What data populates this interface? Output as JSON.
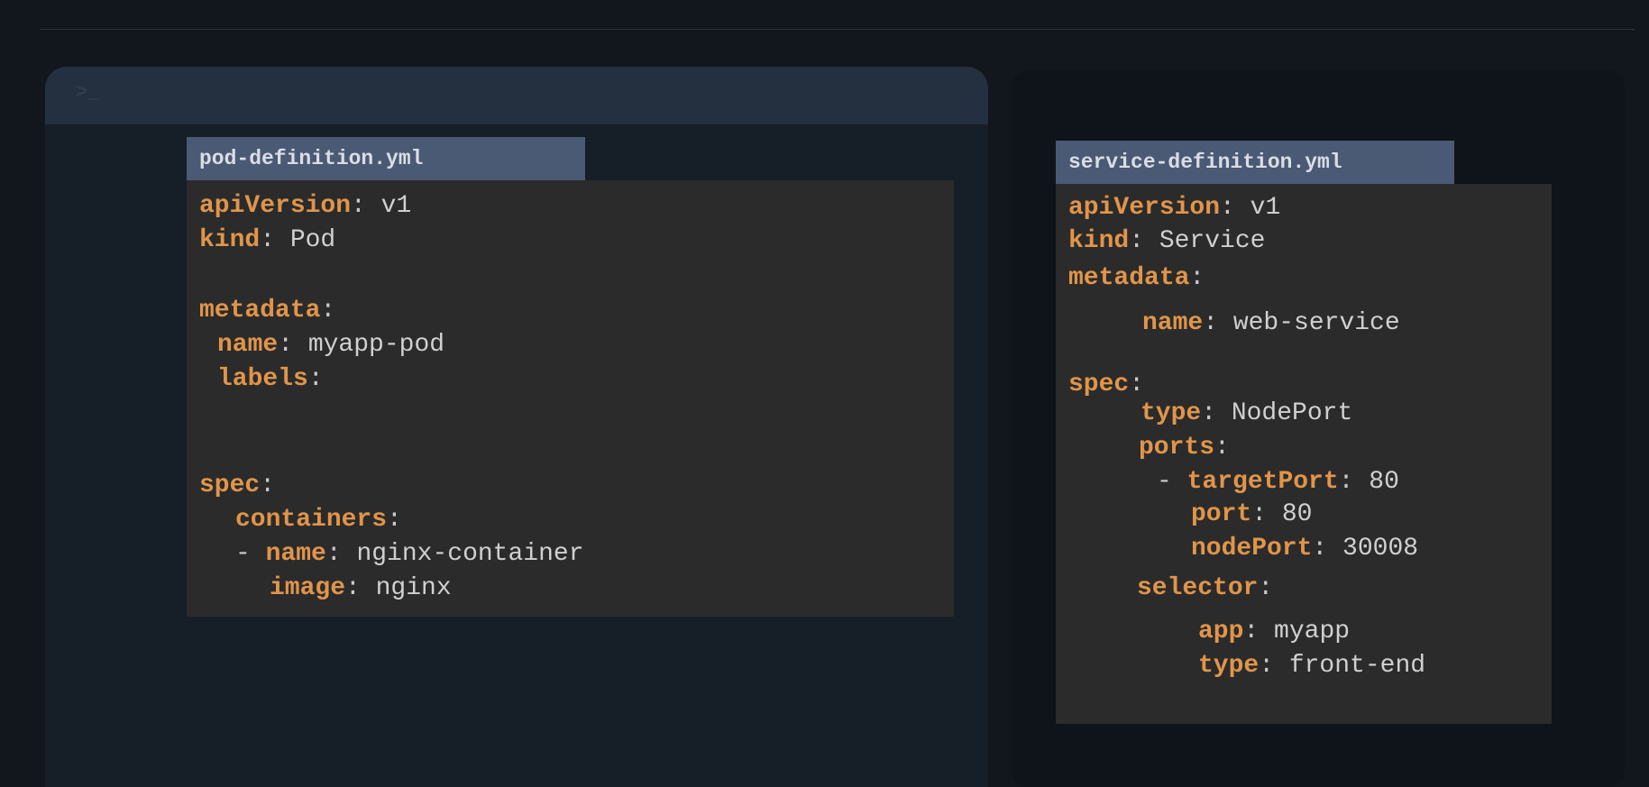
{
  "terminal": {
    "prompt": ">_"
  },
  "pod_file": {
    "filename": "pod-definition.yml",
    "lines": {
      "apiVersion": {
        "key": "apiVersion",
        "value": "v1"
      },
      "kind": {
        "key": "kind",
        "value": "Pod"
      },
      "metadata": {
        "key": "metadata"
      },
      "name": {
        "key": "name",
        "value": "myapp-pod"
      },
      "labels": {
        "key": "labels"
      },
      "spec": {
        "key": "spec"
      },
      "containers": {
        "key": "containers"
      },
      "container_name": {
        "dash": "-",
        "key": "name",
        "value": "nginx-container"
      },
      "image": {
        "key": "image",
        "value": "nginx"
      }
    }
  },
  "service_file": {
    "filename": "service-definition.yml",
    "lines": {
      "apiVersion": {
        "key": "apiVersion",
        "value": "v1"
      },
      "kind": {
        "key": "kind",
        "value": "Service"
      },
      "metadata": {
        "key": "metadata"
      },
      "name": {
        "key": "name",
        "value": "web-service"
      },
      "spec": {
        "key": "spec"
      },
      "type": {
        "key": "type",
        "value": "NodePort"
      },
      "ports": {
        "key": "ports"
      },
      "targetPort": {
        "dash": "-",
        "key": "targetPort",
        "value": "80"
      },
      "port": {
        "key": "port",
        "value": "80"
      },
      "nodePort": {
        "key": "nodePort",
        "value": "30008"
      },
      "selector": {
        "key": "selector"
      },
      "app": {
        "key": "app",
        "value": "myapp"
      },
      "selector_type": {
        "key": "type",
        "value": "front-end"
      }
    }
  },
  "colors": {
    "key": "#e0954a",
    "value": "#d0d0d0",
    "code_background": "#2b2b2b",
    "tab_background": "#4a5a74"
  }
}
